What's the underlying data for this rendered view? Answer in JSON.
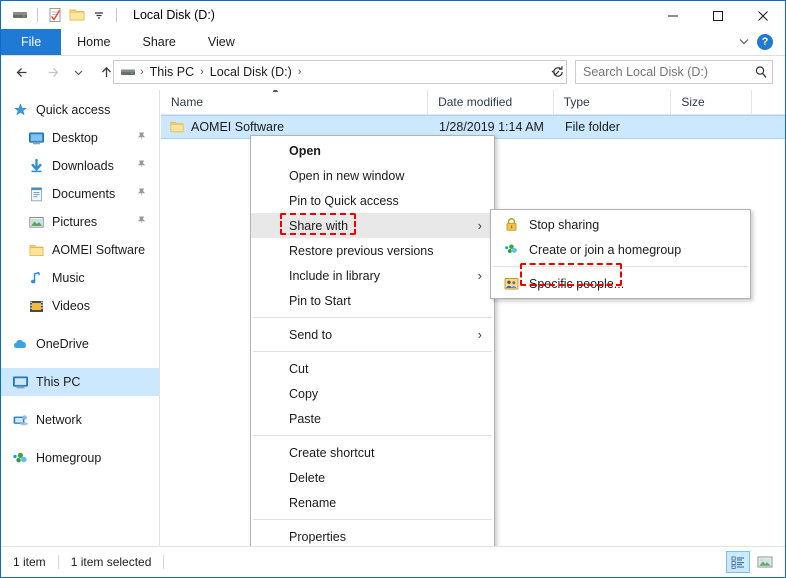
{
  "window": {
    "title": "Local Disk (D:)",
    "quick_access_toolbar": [
      {
        "name": "drive-icon",
        "label": "Properties drive"
      },
      {
        "name": "properties-icon",
        "label": "Properties"
      },
      {
        "name": "new-folder-icon",
        "label": "New folder"
      },
      {
        "name": "customize-chevron-icon",
        "label": "Customize Quick Access Toolbar"
      }
    ],
    "controls": {
      "minimize": "—",
      "maximize": "□",
      "close": "✕",
      "ribbon_expand": "⌄",
      "help": "?"
    }
  },
  "ribbon": {
    "tabs": [
      {
        "label": "File",
        "active": true
      },
      {
        "label": "Home",
        "active": false
      },
      {
        "label": "Share",
        "active": false
      },
      {
        "label": "View",
        "active": false
      }
    ]
  },
  "address_bar": {
    "back": "←",
    "forward": "→",
    "recent_chevron": "⌄",
    "up": "↑",
    "breadcrumb": [
      "This PC",
      "Local Disk (D:)"
    ],
    "breadcrumb_trailing_sep": "›",
    "dropdown_chevron": "⌄",
    "refresh": "↻",
    "search_placeholder": "Search Local Disk (D:)"
  },
  "sidebar": {
    "items": [
      {
        "label": "Quick access",
        "icon": "star-pin-icon",
        "level": "root",
        "pinned": false,
        "selected": false
      },
      {
        "label": "Desktop",
        "icon": "desktop-icon",
        "level": "child",
        "pinned": true,
        "selected": false
      },
      {
        "label": "Downloads",
        "icon": "downloads-icon",
        "level": "child",
        "pinned": true,
        "selected": false
      },
      {
        "label": "Documents",
        "icon": "documents-icon",
        "level": "child",
        "pinned": true,
        "selected": false
      },
      {
        "label": "Pictures",
        "icon": "pictures-icon",
        "level": "child",
        "pinned": true,
        "selected": false
      },
      {
        "label": "AOMEI Software",
        "icon": "folder-icon",
        "level": "child",
        "pinned": false,
        "selected": false
      },
      {
        "label": "Music",
        "icon": "music-icon",
        "level": "child",
        "pinned": false,
        "selected": false
      },
      {
        "label": "Videos",
        "icon": "videos-icon",
        "level": "child",
        "pinned": false,
        "selected": false
      },
      {
        "label": "OneDrive",
        "icon": "onedrive-icon",
        "level": "root",
        "pinned": false,
        "selected": false
      },
      {
        "label": "This PC",
        "icon": "this-pc-icon",
        "level": "root",
        "pinned": false,
        "selected": true
      },
      {
        "label": "Network",
        "icon": "network-icon",
        "level": "root",
        "pinned": false,
        "selected": false
      },
      {
        "label": "Homegroup",
        "icon": "homegroup-icon",
        "level": "root",
        "pinned": false,
        "selected": false
      }
    ]
  },
  "file_list": {
    "columns": [
      "Name",
      "Date modified",
      "Type",
      "Size"
    ],
    "sort_column": "Name",
    "sort_direction": "ascending",
    "rows": [
      {
        "name": "AOMEI Software",
        "date_modified": "1/28/2019 1:14 AM",
        "type": "File folder",
        "size": "",
        "selected": true,
        "icon": "folder-icon"
      }
    ]
  },
  "context_menu": {
    "items": [
      {
        "label": "Open",
        "bold": true,
        "submenu": false,
        "highlighted": false,
        "separator_after": false
      },
      {
        "label": "Open in new window",
        "bold": false,
        "submenu": false,
        "highlighted": false,
        "separator_after": false
      },
      {
        "label": "Pin to Quick access",
        "bold": false,
        "submenu": false,
        "highlighted": false,
        "separator_after": false
      },
      {
        "label": "Share with",
        "bold": false,
        "submenu": true,
        "highlighted": true,
        "separator_after": false
      },
      {
        "label": "Restore previous versions",
        "bold": false,
        "submenu": false,
        "highlighted": false,
        "separator_after": false
      },
      {
        "label": "Include in library",
        "bold": false,
        "submenu": true,
        "highlighted": false,
        "separator_after": false
      },
      {
        "label": "Pin to Start",
        "bold": false,
        "submenu": false,
        "highlighted": false,
        "separator_after": true
      },
      {
        "label": "Send to",
        "bold": false,
        "submenu": true,
        "highlighted": false,
        "separator_after": true
      },
      {
        "label": "Cut",
        "bold": false,
        "submenu": false,
        "highlighted": false,
        "separator_after": false
      },
      {
        "label": "Copy",
        "bold": false,
        "submenu": false,
        "highlighted": false,
        "separator_after": false
      },
      {
        "label": "Paste",
        "bold": false,
        "submenu": false,
        "highlighted": false,
        "separator_after": true
      },
      {
        "label": "Create shortcut",
        "bold": false,
        "submenu": false,
        "highlighted": false,
        "separator_after": false
      },
      {
        "label": "Delete",
        "bold": false,
        "submenu": false,
        "highlighted": false,
        "separator_after": false
      },
      {
        "label": "Rename",
        "bold": false,
        "submenu": false,
        "highlighted": false,
        "separator_after": true
      },
      {
        "label": "Properties",
        "bold": false,
        "submenu": false,
        "highlighted": false,
        "separator_after": false
      }
    ],
    "submenu_arrow": "›"
  },
  "share_submenu": {
    "items": [
      {
        "label": "Stop sharing",
        "icon": "lock-icon",
        "separator_after": false
      },
      {
        "label": "Create or join a homegroup",
        "icon": "homegroup-icon",
        "separator_after": true
      },
      {
        "label": "Specific people...",
        "icon": "specific-people-icon",
        "separator_after": false
      }
    ]
  },
  "annotations": {
    "highlight_color": "#ee0000",
    "targets": [
      "Share with",
      "Specific people..."
    ]
  },
  "status_bar": {
    "item_count": "1 item",
    "selection": "1 item selected",
    "views": [
      {
        "name": "details-view-button",
        "active": true
      },
      {
        "name": "large-icons-view-button",
        "active": false
      }
    ]
  }
}
